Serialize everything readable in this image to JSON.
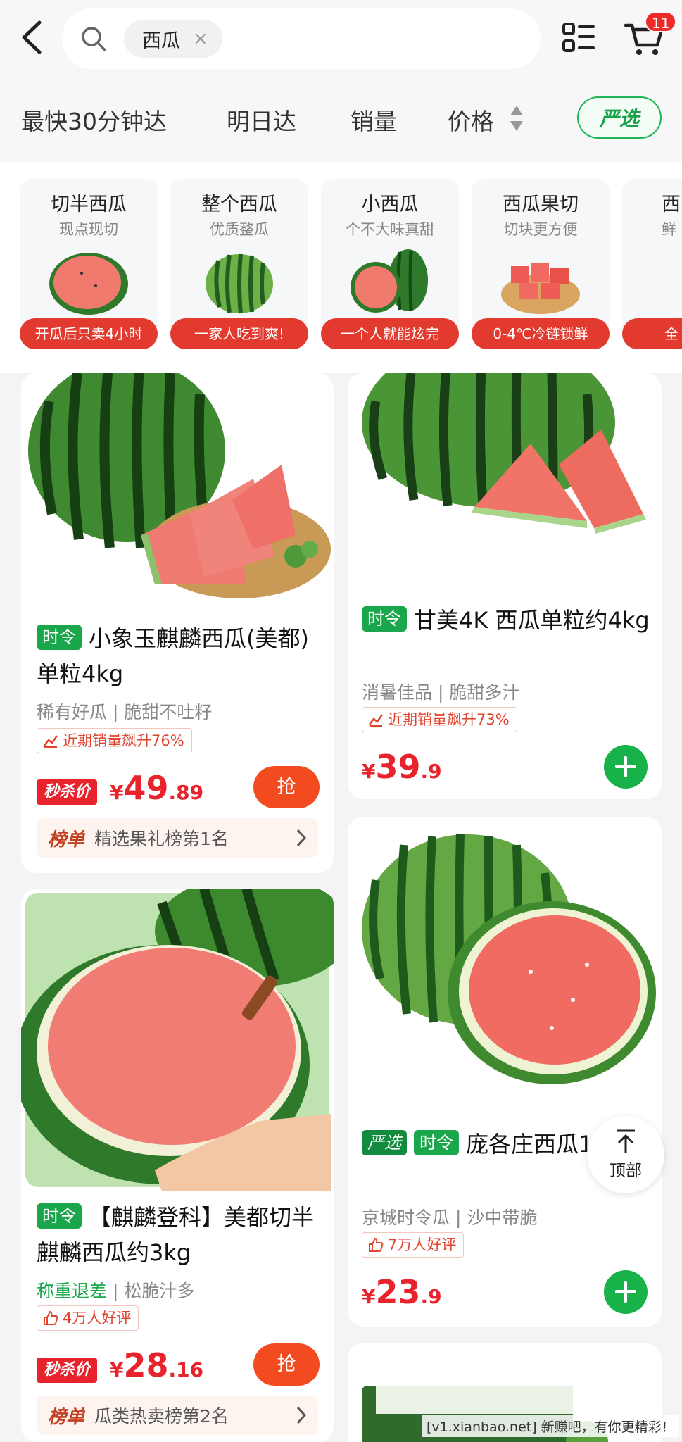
{
  "header": {
    "search_chip": "西瓜",
    "chip_close": "×",
    "cart_count": "11"
  },
  "filters": {
    "fastest": "最快30分钟达",
    "next_day": "明日达",
    "sales": "销量",
    "price": "价格",
    "yanxuan": "严选"
  },
  "categories": [
    {
      "name": "切半西瓜",
      "sub": "现点现切",
      "tag": "开瓜后只卖4小时"
    },
    {
      "name": "整个西瓜",
      "sub": "优质整瓜",
      "tag": "一家人吃到爽!"
    },
    {
      "name": "小西瓜",
      "sub": "个不大味真甜",
      "tag": "一个人就能炫完"
    },
    {
      "name": "西瓜果切",
      "sub": "切块更方便",
      "tag": "0-4℃冷链锁鲜"
    },
    {
      "name": "西",
      "sub": "鲜",
      "tag": "全"
    }
  ],
  "products": {
    "p1": {
      "tag": "时令",
      "title": "小象玉麒麟西瓜(美都)单粒4kg",
      "sub_a": "稀有好瓜",
      "sub_sep": "|",
      "sub_b": "脆甜不吐籽",
      "badge": "近期销量飙升76%",
      "ms_label": "秒杀价",
      "yen": "¥",
      "price_int": "49",
      "price_dec": ".89",
      "grab": "抢",
      "rank_label": "榜单",
      "rank_text": "精选果礼榜第1名"
    },
    "p2": {
      "tag": "时令",
      "title": "甘美4K 西瓜单粒约4kg",
      "sub_a": "消暑佳品",
      "sub_sep": "|",
      "sub_b": "脆甜多汁",
      "badge": "近期销量飙升73%",
      "yen": "¥",
      "price_int": "39",
      "price_dec": ".9"
    },
    "p3": {
      "tag": "时令",
      "title": "【麒麟登科】美都切半麒麟西瓜约3kg",
      "sub_a": "称重退差",
      "sub_sep": "|",
      "sub_b": "松脆汁多",
      "badge": "4万人好评",
      "ms_label": "秒杀价",
      "yen": "¥",
      "price_int": "28",
      "price_dec": ".16",
      "grab": "抢",
      "rank_label": "榜单",
      "rank_text": "瓜类热卖榜第2名"
    },
    "p4": {
      "tag_a": "严选",
      "tag_b": "时令",
      "title": "庞各庄西瓜1.5kg",
      "sub_a": "京城时令瓜",
      "sub_sep": "|",
      "sub_b": "沙中带脆",
      "badge": "7万人好评",
      "yen": "¥",
      "price_int": "23",
      "price_dec": ".9"
    }
  },
  "to_top": "顶部",
  "watermark": "[v1.xianbao.net] 新赚吧，有你更精彩！",
  "colors": {
    "accent_red": "#e8232c",
    "accent_green": "#18b24a",
    "tag_red": "#e23a2e"
  }
}
